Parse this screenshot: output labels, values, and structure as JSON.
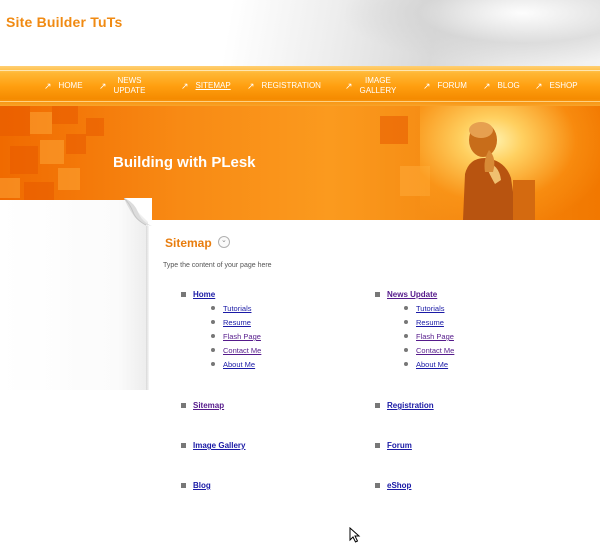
{
  "site": {
    "title": "Site Builder TuTs"
  },
  "nav": {
    "items": [
      {
        "label": "HOME",
        "active": false
      },
      {
        "label": "NEWS UPDATE",
        "line1": "NEWS",
        "line2": "UPDATE",
        "active": false
      },
      {
        "label": "SITEMAP",
        "active": true
      },
      {
        "label": "REGISTRATION",
        "active": false
      },
      {
        "label": "IMAGE GALLERY",
        "line1": "IMAGE",
        "line2": "GALLERY",
        "active": false
      },
      {
        "label": "FORUM",
        "active": false
      },
      {
        "label": "BLOG",
        "active": false
      },
      {
        "label": "ESHOP",
        "active": false
      }
    ]
  },
  "banner": {
    "title": "Building with PLesk"
  },
  "page": {
    "title": "Sitemap",
    "intro": "Type the content of your page here"
  },
  "sitemap": {
    "home": {
      "label": "Home",
      "children": [
        "Tutorials",
        "Resume",
        "Flash Page",
        "Contact Me",
        "About Me"
      ]
    },
    "news": {
      "label": "News Update",
      "children": [
        "Tutorials",
        "Resume",
        "Flash Page",
        "Contact Me",
        "About Me"
      ]
    },
    "sitemap": {
      "label": "Sitemap"
    },
    "registration": {
      "label": "Registration"
    },
    "image_gallery": {
      "label": "Image Gallery"
    },
    "forum": {
      "label": "Forum"
    },
    "blog": {
      "label": "Blog"
    },
    "eshop": {
      "label": "eShop"
    }
  },
  "colors": {
    "accent": "#f08a12",
    "nav_orange": "#ff9f10",
    "link": "#1a1aa6",
    "visited": "#551a8b"
  },
  "icons": {
    "nav_arrow": "arrow-northeast-icon",
    "title_button": "chevron-down-circle-icon"
  }
}
